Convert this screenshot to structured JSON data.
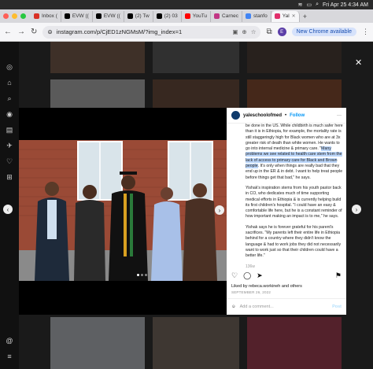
{
  "menubar": {
    "datetime": "Fri Apr 25  4:34 AM"
  },
  "tabs": [
    {
      "title": "Inbox (",
      "color": "#d93025"
    },
    {
      "title": "EVW ((",
      "color": "#000000"
    },
    {
      "title": "EVW ((",
      "color": "#000000"
    },
    {
      "title": "(2) Tw",
      "color": "#000000"
    },
    {
      "title": "(2) 03",
      "color": "#000000"
    },
    {
      "title": "YouTu",
      "color": "#ff0000"
    },
    {
      "title": "Carnec",
      "color": "#c13584"
    },
    {
      "title": "stanfo",
      "color": "#4285f4"
    },
    {
      "title": "Yal",
      "color": "#e1306c"
    }
  ],
  "toolbar": {
    "url": "instagram.com/p/CjED1zNGMsM/?img_index=1",
    "profile_initial": "E",
    "new_chrome_label": "New Chrome available"
  },
  "post": {
    "username": "yaleschoolofmed",
    "follow_label": "Follow",
    "caption_pre": "be done in the US. While childbirth is much safer here than it is in Ethiopia, for example, the mortality rate is still staggeringly high for Black women who are at 3x greater risk of death than white women. He wants to go into internal medicine & primary care. \"",
    "caption_highlight": "Many problems we see related to health care stem from the lack of access to primary care for Black and Brown people",
    "caption_post": ". It's only when things are really bad that they end up in the ER & in debt. I want to help treat people before things get that bad,\" he says.",
    "caption_p2": "Yishak's inspiration stems from his youth pastor back in CO, who dedicates much of time supporting medical efforts in Ethiopia & is currently helping build its first children's hospital. \"I could have an easy & comfortable life here, but he is a constant reminder of how important making an impact is to me,\" he says.",
    "caption_p3": "Yishak says he is forever grateful for his parent's sacrifices. \"My parents left their entire life in Ethiopia behind for a country where they didn't know the language & had to work jobs they did not necessarily want to work just so that their children could have a better life.\"",
    "timestamp": "136w",
    "liked_by": "Liked by rebeca.workineh and others",
    "date": "SEPTEMBER 26, 2022",
    "comment_placeholder": "Add a comment...",
    "post_label": "Post"
  },
  "colors": {
    "accent": "#0095f6",
    "highlight": "#bcd7fb"
  }
}
